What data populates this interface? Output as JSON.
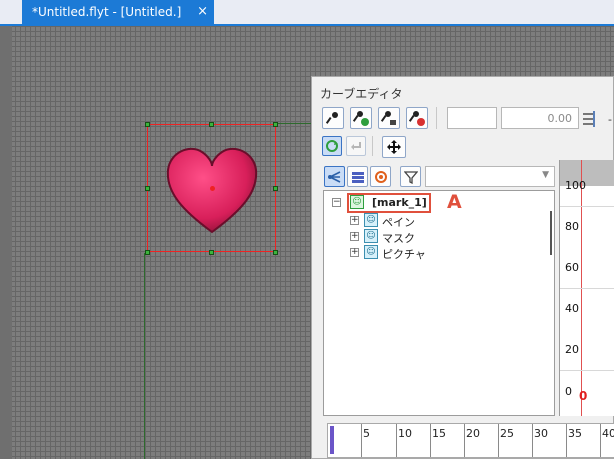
{
  "tab": {
    "title": "*Untitled.flyt - [Untitled.]",
    "close": "×"
  },
  "editor": {
    "title": "カーブエディタ",
    "value_field": "0.00",
    "filter_placeholder": ""
  },
  "tree": {
    "root": "[mark_1]",
    "children": [
      "ペイン",
      "マスク",
      "ピクチャ"
    ]
  },
  "callout_label": "A",
  "graph": {
    "labels": [
      "100",
      "80",
      "60",
      "40",
      "20",
      "0"
    ],
    "zero_marker": "0"
  },
  "timeline": {
    "ticks": [
      "5",
      "10",
      "15",
      "20",
      "25",
      "30",
      "35",
      "40"
    ]
  },
  "colors": {
    "accent": "#1c7ad6",
    "selection": "#e22222",
    "callout": "#e0503c",
    "heart": "#d81f5a"
  }
}
